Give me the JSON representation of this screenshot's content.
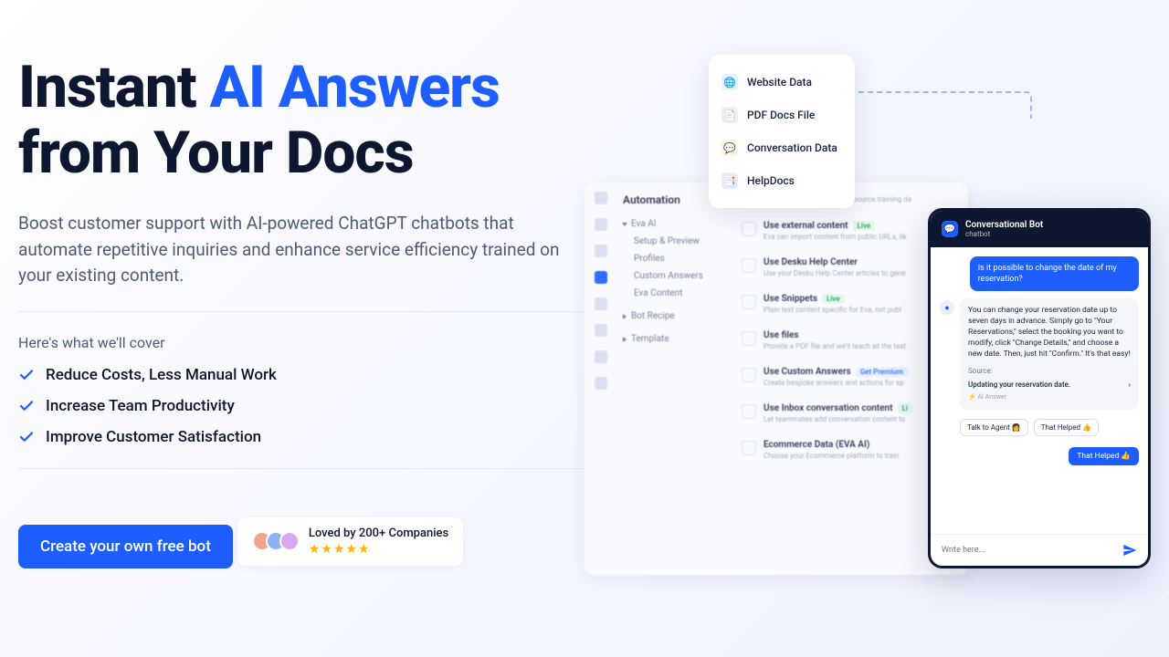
{
  "hero": {
    "title_1": "Instant ",
    "title_hl": "AI Answers",
    "title_2": " from Your Docs",
    "subtitle": "Boost customer support with AI-powered ChatGPT chatbots that automate repetitive inquiries and enhance service efficiency trained on your existing content.",
    "cover_label": "Here's what we'll cover",
    "features": [
      "Reduce Costs, Less Manual Work",
      "Increase Team Productivity",
      "Improve Customer Satisfaction"
    ],
    "cta": "Create your own free bot",
    "social_proof": "Loved by 200+ Companies",
    "stars": "★★★★★"
  },
  "sources": [
    {
      "label": "Website Data",
      "icon": "web"
    },
    {
      "label": "PDF Docs File",
      "icon": "pdf"
    },
    {
      "label": "Conversation Data",
      "icon": "conv"
    },
    {
      "label": "HelpDocs",
      "icon": "help"
    }
  ],
  "app": {
    "title": "Automation",
    "tree": {
      "root": "Eva AI",
      "items": [
        "Setup & Preview",
        "Profiles",
        "Custom Answers",
        "Eva Content"
      ],
      "others": [
        "Bot Recipe",
        "Template"
      ]
    },
    "content_hint": "Choose from the options below to source training da",
    "options": [
      {
        "title": "Use external content",
        "badge": "Live",
        "badge_type": "live",
        "desc": "Eva can import content from public URLs, lik"
      },
      {
        "title": "Use Desku Help Center",
        "badge": "",
        "badge_type": "",
        "desc": "Use your Desku Help Center articles to gene"
      },
      {
        "title": "Use Snippets",
        "badge": "Live",
        "badge_type": "live",
        "desc": "Plain text content specific for Eva, not publ"
      },
      {
        "title": "Use files",
        "badge": "",
        "badge_type": "",
        "desc": "Provide a PDF file and we'll teach all the text"
      },
      {
        "title": "Use Custom Answers",
        "badge": "Get Premium",
        "badge_type": "prem",
        "desc": "Create bespoke answers and actions for sp"
      },
      {
        "title": "Use Inbox conversation content",
        "badge": "Li",
        "badge_type": "live",
        "desc": "Let teammates add conversation content to"
      },
      {
        "title": "Ecommerce Data (EVA AI)",
        "badge": "",
        "badge_type": "",
        "desc": "Choose your Ecommerce platform to train"
      }
    ]
  },
  "chat": {
    "title": "Conversational Bot",
    "subtitle": "chatbot",
    "user_msg": "Is it possible to change the date of my reservation?",
    "bot_msg": "You can change your reservation date up to seven days in advance. Simply go to \"Your Reservations,\" select the booking you want to modify, click \"Change Details,\" and choose a new date. Then, just hit \"Confirm.\" It's that easy!",
    "source_label": "Source:",
    "source_link": "Updating your reservation date.",
    "ai_tag": "⚡ AI Answer",
    "chip_agent": "Talk to Agent 👩",
    "chip_helped": "That Helped 👍",
    "reply_helped": "That Helped 👍",
    "placeholder": "Write here..."
  }
}
